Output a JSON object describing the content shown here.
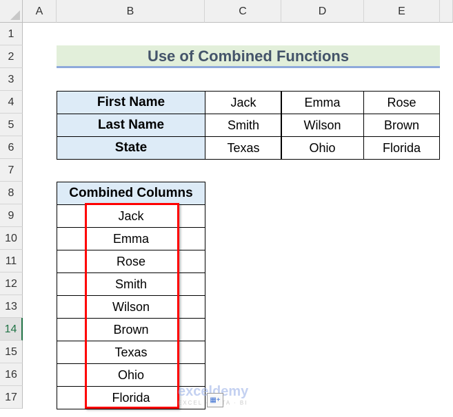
{
  "columns": [
    "A",
    "B",
    "C",
    "D",
    "E"
  ],
  "rows": [
    "1",
    "2",
    "3",
    "4",
    "5",
    "6",
    "7",
    "8",
    "9",
    "10",
    "11",
    "12",
    "13",
    "14",
    "15",
    "16",
    "17"
  ],
  "title": "Use of Combined Functions",
  "table": {
    "headers": [
      "First Name",
      "Last Name",
      "State"
    ],
    "rows": [
      [
        "Jack",
        "Emma",
        "Rose"
      ],
      [
        "Smith",
        "Wilson",
        "Brown"
      ],
      [
        "Texas",
        "Ohio",
        "Florida"
      ]
    ]
  },
  "combined": {
    "header": "Combined Columns",
    "values": [
      "Jack",
      "Emma",
      "Rose",
      "Smith",
      "Wilson",
      "Brown",
      "Texas",
      "Ohio",
      "Florida"
    ]
  },
  "watermark": {
    "name": "exceldemy",
    "tagline": "EXCEL · DATA · BI"
  },
  "colors": {
    "title_bg": "#e2efda",
    "header_bg": "#ddebf7",
    "highlight": "#ff0000"
  }
}
